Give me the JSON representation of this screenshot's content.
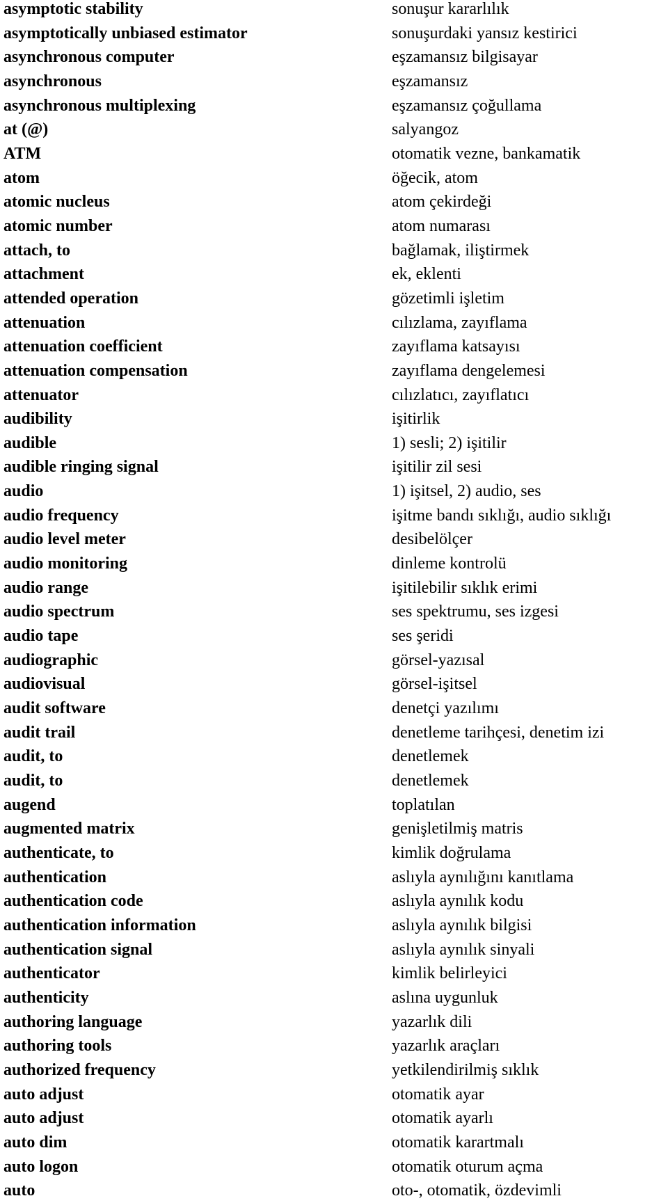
{
  "entries": [
    {
      "term": "asymptotic stability",
      "translation": "sonuşur kararlılık"
    },
    {
      "term": "asymptotically unbiased estimator",
      "translation": "sonuşurdaki yansız kestirici"
    },
    {
      "term": "asynchronous computer",
      "translation": "eşzamansız bilgisayar"
    },
    {
      "term": "asynchronous",
      "translation": "eşzamansız"
    },
    {
      "term": "asynchronous multiplexing",
      "translation": "eşzamansız çoğullama"
    },
    {
      "term": "at (@)",
      "translation": "salyangoz"
    },
    {
      "term": "ATM",
      "translation": "otomatik vezne, bankamatik"
    },
    {
      "term": "atom",
      "translation": "öğecik, atom"
    },
    {
      "term": "atomic nucleus",
      "translation": "atom çekirdeği"
    },
    {
      "term": "atomic number",
      "translation": "atom numarası"
    },
    {
      "term": "attach, to",
      "translation": "bağlamak, iliştirmek"
    },
    {
      "term": "attachment",
      "translation": "ek, eklenti"
    },
    {
      "term": "attended operation",
      "translation": "gözetimli işletim"
    },
    {
      "term": "attenuation",
      "translation": "cılızlama, zayıflama"
    },
    {
      "term": "attenuation coefficient",
      "translation": "zayıflama katsayısı"
    },
    {
      "term": "attenuation compensation",
      "translation": "zayıflama dengelemesi"
    },
    {
      "term": "attenuator",
      "translation": "cılızlatıcı, zayıflatıcı"
    },
    {
      "term": "audibility",
      "translation": "işitirlik"
    },
    {
      "term": "audible",
      "translation": "1) sesli; 2) işitilir"
    },
    {
      "term": "audible ringing signal",
      "translation": "işitilir zil sesi"
    },
    {
      "term": "audio",
      "translation": "1) işitsel, 2) audio, ses"
    },
    {
      "term": "audio frequency",
      "translation": "işitme bandı sıklığı, audio sıklığı"
    },
    {
      "term": "audio level meter",
      "translation": "desibelölçer"
    },
    {
      "term": "audio monitoring",
      "translation": "dinleme kontrolü"
    },
    {
      "term": "audio range",
      "translation": "işitilebilir sıklık erimi"
    },
    {
      "term": "audio spectrum",
      "translation": "ses spektrumu, ses izgesi"
    },
    {
      "term": "audio tape",
      "translation": "ses şeridi"
    },
    {
      "term": "audiographic",
      "translation": "görsel-yazısal"
    },
    {
      "term": "audiovisual",
      "translation": "görsel-işitsel"
    },
    {
      "term": "audit software",
      "translation": "denetçi yazılımı"
    },
    {
      "term": "audit trail",
      "translation": "denetleme tarihçesi, denetim izi"
    },
    {
      "term": "audit, to",
      "translation": "denetlemek"
    },
    {
      "term": "audit, to",
      "translation": "denetlemek"
    },
    {
      "term": "augend",
      "translation": "toplatılan"
    },
    {
      "term": "augmented matrix",
      "translation": "genişletilmiş matris"
    },
    {
      "term": "authenticate, to",
      "translation": "kimlik doğrulama"
    },
    {
      "term": "authentication",
      "translation": "aslıyla aynılığını kanıtlama"
    },
    {
      "term": "authentication code",
      "translation": "aslıyla aynılık kodu"
    },
    {
      "term": "authentication information",
      "translation": "aslıyla aynılık bilgisi"
    },
    {
      "term": "authentication signal",
      "translation": "aslıyla aynılık sinyali"
    },
    {
      "term": "authenticator",
      "translation": "kimlik belirleyici"
    },
    {
      "term": "authenticity",
      "translation": "aslına uygunluk"
    },
    {
      "term": "authoring language",
      "translation": "yazarlık dili"
    },
    {
      "term": "authoring tools",
      "translation": "yazarlık araçları"
    },
    {
      "term": "authorized frequency",
      "translation": "yetkilendirilmiş sıklık"
    },
    {
      "term": "auto adjust",
      "translation": "otomatik ayar"
    },
    {
      "term": "auto adjust",
      "translation": "otomatik ayarlı"
    },
    {
      "term": "auto dim",
      "translation": "otomatik karartmalı"
    },
    {
      "term": "auto logon",
      "translation": "otomatik oturum açma"
    },
    {
      "term": "auto",
      "translation": "oto-, otomatik, özdevimli"
    }
  ]
}
